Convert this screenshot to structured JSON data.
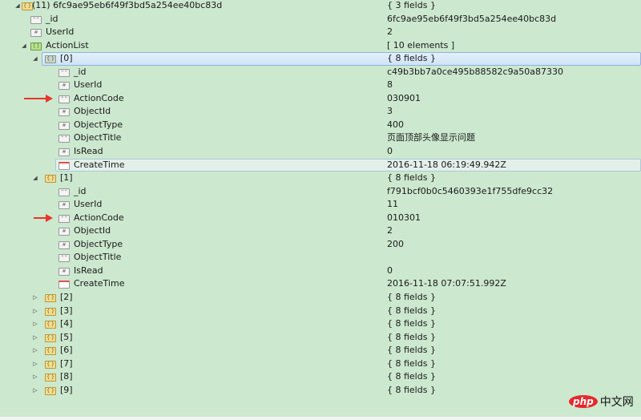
{
  "rows": [
    {
      "level": 0,
      "arrow": "expanded",
      "icon": "obj",
      "key": "(11) 6fc9ae95eb6f49f3bd5a254ee40bc83d",
      "value": "{ 3 fields }"
    },
    {
      "level": 1,
      "icon": "str",
      "key": "_id",
      "value": "6fc9ae95eb6f49f3bd5a254ee40bc83d"
    },
    {
      "level": 1,
      "icon": "num",
      "key": "UserId",
      "value": "2"
    },
    {
      "level": 1,
      "arrow": "expanded",
      "icon": "arr",
      "key": "ActionList",
      "value": "[ 10 elements ]"
    },
    {
      "level": 2,
      "arrow": "expanded",
      "icon": "objsel",
      "key": "[0]",
      "value": "{ 8 fields }",
      "state": "selected"
    },
    {
      "level": 3,
      "icon": "str",
      "key": "_id",
      "value": "c49b3bb7a0ce495b88582c9a50a87330"
    },
    {
      "level": 3,
      "icon": "num",
      "key": "UserId",
      "value": "8"
    },
    {
      "level": 3,
      "icon": "str",
      "key": "ActionCode",
      "value": "030901",
      "marker": true
    },
    {
      "level": 3,
      "icon": "num",
      "key": "ObjectId",
      "value": "3"
    },
    {
      "level": 3,
      "icon": "num",
      "key": "ObjectType",
      "value": "400"
    },
    {
      "level": 3,
      "icon": "str",
      "key": "ObjectTitle",
      "value": "页面顶部头像显示问题"
    },
    {
      "level": 3,
      "icon": "num",
      "key": "IsRead",
      "value": "0"
    },
    {
      "level": 3,
      "icon": "date",
      "key": "CreateTime",
      "value": "2016-11-18 06:19:49.942Z",
      "state": "hover"
    },
    {
      "level": 2,
      "arrow": "expanded",
      "icon": "obj",
      "key": "[1]",
      "value": "{ 8 fields }"
    },
    {
      "level": 3,
      "icon": "str",
      "key": "_id",
      "value": "f791bcf0b0c5460393e1f755dfe9cc32"
    },
    {
      "level": 3,
      "icon": "num",
      "key": "UserId",
      "value": "11"
    },
    {
      "level": 3,
      "icon": "str",
      "key": "ActionCode",
      "value": "010301",
      "marker": true
    },
    {
      "level": 3,
      "icon": "num",
      "key": "ObjectId",
      "value": "2"
    },
    {
      "level": 3,
      "icon": "num",
      "key": "ObjectType",
      "value": "200"
    },
    {
      "level": 3,
      "icon": "str",
      "key": "ObjectTitle",
      "value": ""
    },
    {
      "level": 3,
      "icon": "num",
      "key": "IsRead",
      "value": "0"
    },
    {
      "level": 3,
      "icon": "date",
      "key": "CreateTime",
      "value": "2016-11-18 07:07:51.992Z"
    },
    {
      "level": 2,
      "arrow": "collapsed",
      "icon": "obj",
      "key": "[2]",
      "value": "{ 8 fields }"
    },
    {
      "level": 2,
      "arrow": "collapsed",
      "icon": "obj",
      "key": "[3]",
      "value": "{ 8 fields }"
    },
    {
      "level": 2,
      "arrow": "collapsed",
      "icon": "obj",
      "key": "[4]",
      "value": "{ 8 fields }"
    },
    {
      "level": 2,
      "arrow": "collapsed",
      "icon": "obj",
      "key": "[5]",
      "value": "{ 8 fields }"
    },
    {
      "level": 2,
      "arrow": "collapsed",
      "icon": "obj",
      "key": "[6]",
      "value": "{ 8 fields }"
    },
    {
      "level": 2,
      "arrow": "collapsed",
      "icon": "obj",
      "key": "[7]",
      "value": "{ 8 fields }"
    },
    {
      "level": 2,
      "arrow": "collapsed",
      "icon": "obj",
      "key": "[8]",
      "value": "{ 8 fields }"
    },
    {
      "level": 2,
      "arrow": "collapsed",
      "icon": "obj",
      "key": "[9]",
      "value": "{ 8 fields }"
    }
  ],
  "watermark": {
    "php": "php",
    "cn": "中文网"
  }
}
